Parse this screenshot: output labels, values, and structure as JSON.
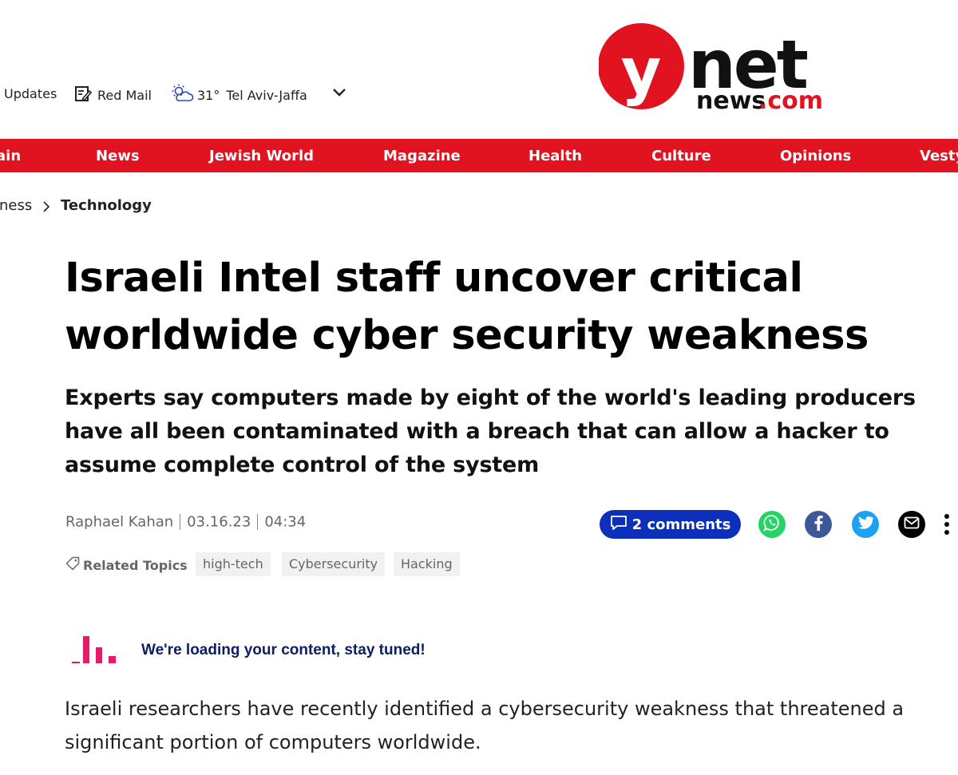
{
  "utility_bar": {
    "updates_label": "Updates",
    "redmail_label": "Red Mail",
    "weather_temp": "31°",
    "weather_city": "Tel Aviv-Jaffa"
  },
  "logo": {
    "primary": "ynet",
    "secondary_a": "news",
    "secondary_b": ".com"
  },
  "nav": {
    "items": [
      "ain",
      "News",
      "Jewish World",
      "Magazine",
      "Health",
      "Culture",
      "Opinions",
      "Vesty"
    ]
  },
  "breadcrumb": {
    "previous": "ness",
    "current": "Technology"
  },
  "article": {
    "title_line1": "Israeli Intel staff uncover critical",
    "title_line2": "worldwide cyber security weakness",
    "subtitle": "Experts say computers made by eight of the world's leading producers have all been contaminated with a breach that can allow a hacker to assume complete control of the system",
    "author": "Raphael Kahan",
    "date": "03.16.23",
    "time": "04:34",
    "comments_label": "2 comments",
    "related_topics_label": "Related Topics",
    "tags": [
      "high-tech",
      "Cybersecurity",
      "Hacking"
    ],
    "loading_message": "We're loading your content, stay tuned!",
    "body_paragraph": "Israeli researchers have recently identified a cybersecurity weakness that threatened a significant portion of computers worldwide."
  },
  "icons": [
    "edit-note-icon",
    "weather-sun-cloud-icon",
    "chevron-down-icon",
    "chevron-right-icon",
    "comment-icon",
    "whatsapp-icon",
    "facebook-icon",
    "twitter-icon",
    "mail-icon",
    "more-vertical-icon",
    "tag-icon",
    "loading-bars-icon"
  ],
  "colors": {
    "brand_red": "#e21320",
    "comments_blue": "#0c2fbc",
    "whatsapp": "#25d366",
    "facebook": "#3b5998",
    "twitter": "#1da1f2",
    "loading_pink": "#e8186a"
  }
}
